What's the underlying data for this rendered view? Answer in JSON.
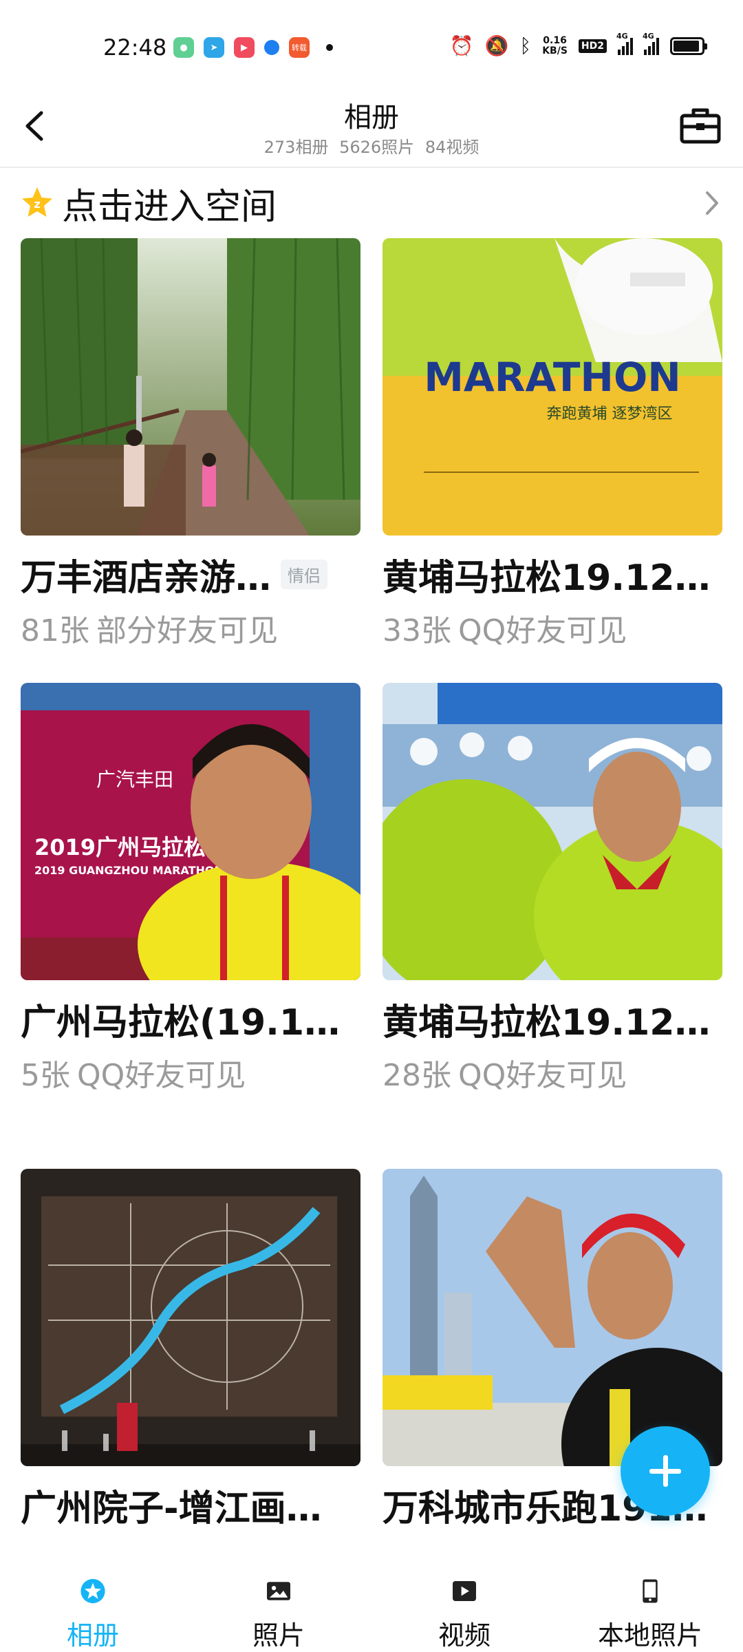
{
  "status_bar": {
    "time": "22:48",
    "app_icons": [
      {
        "name": "wechat-icon",
        "color": "#5fcf94"
      },
      {
        "name": "telegram-icon",
        "color": "#2ea6e8"
      },
      {
        "name": "video-app-icon",
        "color": "#f04b5e"
      },
      {
        "name": "qq-browser-icon",
        "color": "#1d7ff0"
      },
      {
        "name": "news-app-icon",
        "color": "#f25a30",
        "text": "转载"
      }
    ],
    "net_speed_value": "0.16",
    "net_speed_unit": "KB/S",
    "hd_label": "HD2",
    "signal_1_label": "4G",
    "signal_2_label": "4G"
  },
  "header": {
    "title": "相册",
    "albums_count": "273相册",
    "photos_count": "5626照片",
    "videos_count": "84视频"
  },
  "space_banner": {
    "label": "点击进入空间"
  },
  "albums": [
    {
      "title": "万丰酒店亲游…",
      "tag": "情侣",
      "count": "81张",
      "visibility": "部分好友可见"
    },
    {
      "title": "黄埔马拉松19.12.…",
      "tag": "",
      "count": "33张",
      "visibility": "QQ好友可见"
    },
    {
      "title": "广州马拉松(19.1…",
      "tag": "",
      "count": "5张",
      "visibility": "QQ好友可见"
    },
    {
      "title": "黄埔马拉松19.12.…",
      "tag": "",
      "count": "28张",
      "visibility": "QQ好友可见"
    },
    {
      "title": "广州院子-增江画…",
      "tag": "",
      "count": "",
      "visibility": ""
    },
    {
      "title": "万科城市乐跑191…",
      "tag": "",
      "count": "",
      "visibility": ""
    }
  ],
  "thumb_text": {
    "marathon_banner": "MARATHON",
    "marathon_slogan": "奔跑黄埔 逐梦湾区",
    "gz_marathon_event": "2019广州马拉松赛",
    "gz_marathon_en": "2019 GUANGZHOU MARATHON",
    "sponsor": "广汽丰田"
  },
  "bottom_nav": {
    "items": [
      {
        "label": "相册",
        "active": true
      },
      {
        "label": "照片",
        "active": false
      },
      {
        "label": "视频",
        "active": false
      },
      {
        "label": "本地照片",
        "active": false
      }
    ]
  },
  "colors": {
    "accent": "#16b4f6",
    "muted_text": "#9a9a9a"
  }
}
